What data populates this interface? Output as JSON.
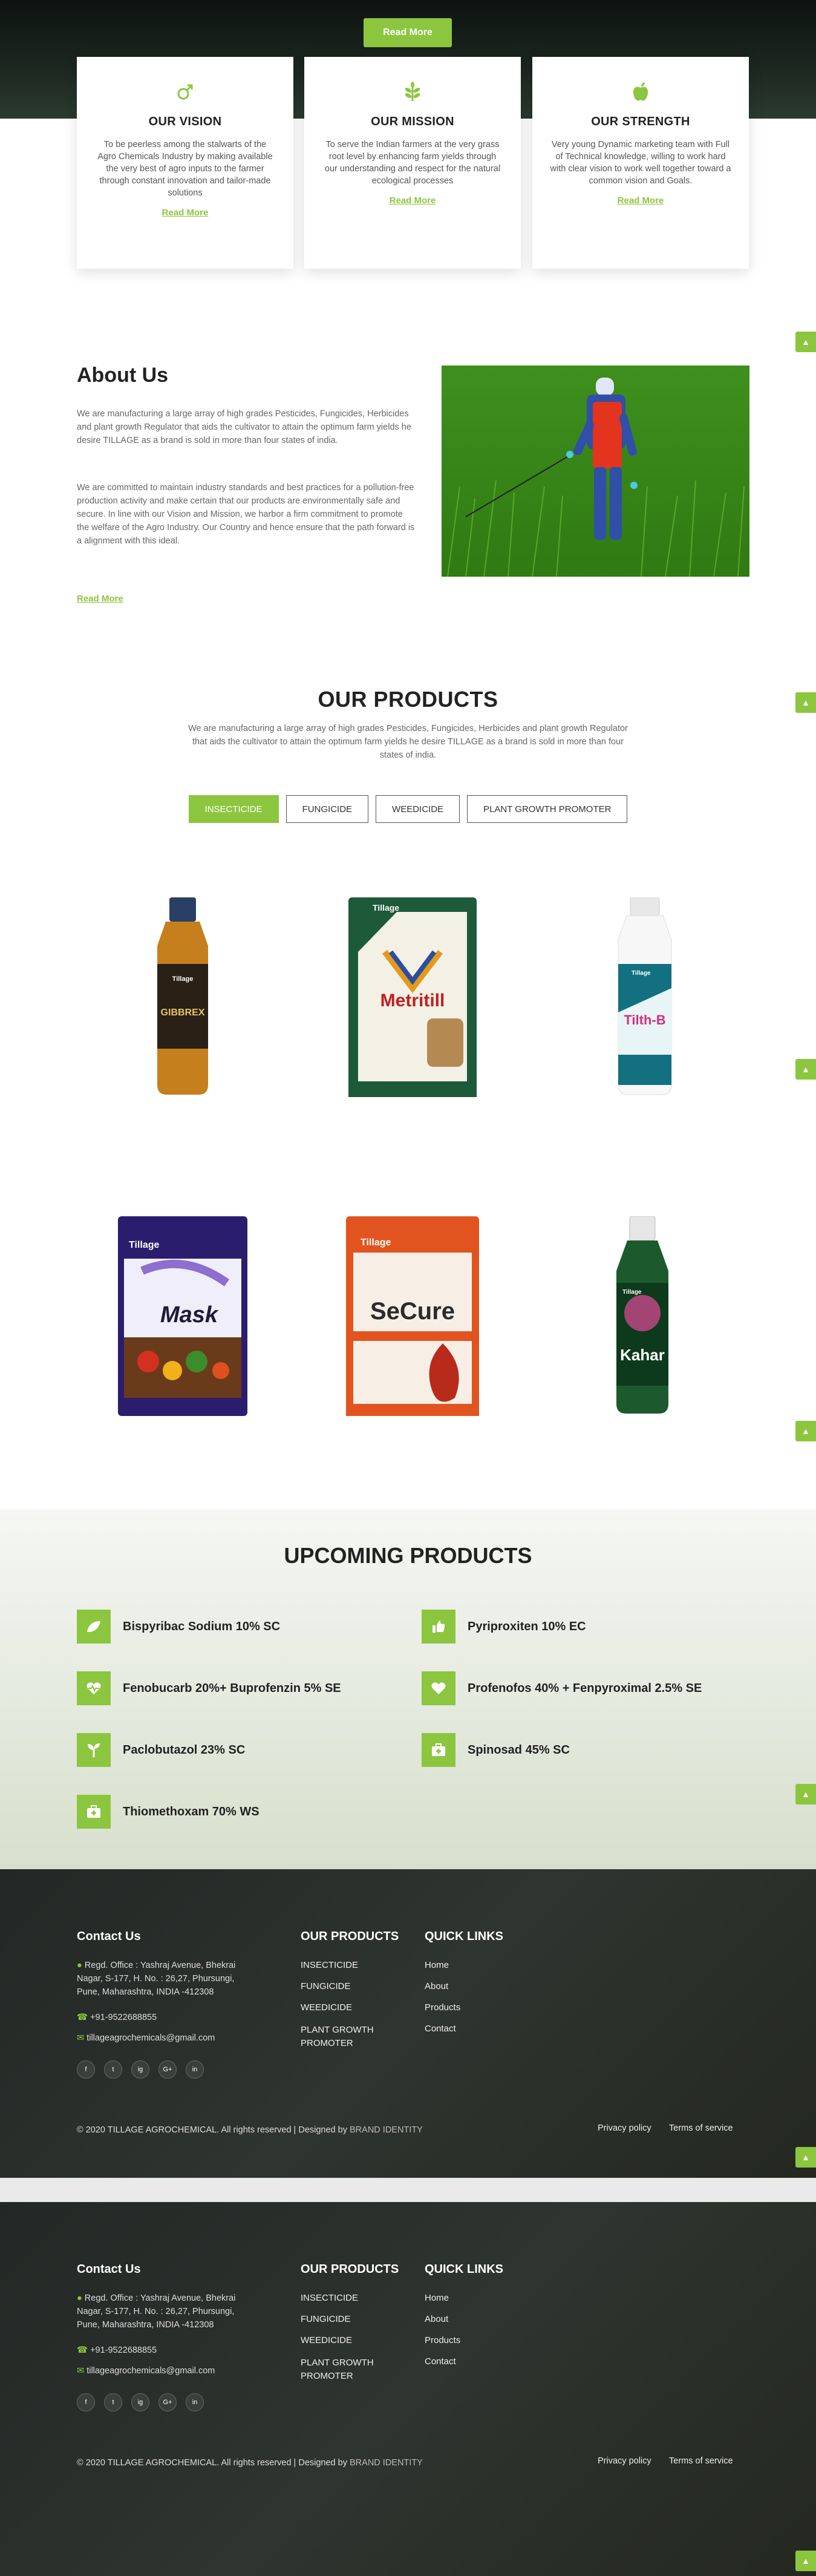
{
  "hero": {
    "read_more": "Read More"
  },
  "cards": [
    {
      "title": "OUR VISION",
      "text": "To be peerless among the stalwarts of the Agro Chemicals Industry by making available the very best of agro inputs to the farmer through constant innovation and tailor-made solutions",
      "link": "Read More",
      "icon": "gender-leaf-icon"
    },
    {
      "title": "OUR MISSION",
      "text": "To serve the Indian farmers at the very grass root level by enhancing farm yields through our understanding and respect for the natural ecological processes",
      "link": "Read More",
      "icon": "leaf-icon"
    },
    {
      "title": "OUR STRENGTH",
      "text": "Very young Dynamic marketing team with Full of Technical knowledge, willing to work hard with clear vision to work well together toward a common vision and Goals.",
      "link": "Read More",
      "icon": "apple-icon"
    }
  ],
  "about": {
    "title": "About Us",
    "p1": "We are manufacturing a large array of high grades Pesticides, Fungicides, Herbicides and plant growth Regulator that aids the cultivator to attain the optimum farm yields he desire TILLAGE as a brand is sold in more than four states of india.",
    "p2": "We are committed to maintain industry standards and best practices for a pollution-free production activity and make certain that our products are environmentally safe and secure. In line with our Vision and Mission, we harbor a firm commitment to promote the welfare of the Agro Industry. Our Country and hence ensure that the path forward is a alignment with this ideal.",
    "read_more": "Read More"
  },
  "products": {
    "title": "OUR PRODUCTS",
    "text": "We are manufacturing a large array of high grades Pesticides, Fungicides, Herbicides and plant growth Regulator that aids the cultivator to attain the optimum farm yields he desire TILLAGE as a brand is sold in more than four states of india.",
    "tabs": [
      "INSECTICIDE",
      "FUNGICIDE",
      "WEEDICIDE",
      "PLANT GROWTH PROMOTER"
    ],
    "items": [
      {
        "brand": "Tillage",
        "name": "GIBBREX"
      },
      {
        "brand": "Tillage",
        "name": "Metritill"
      },
      {
        "brand": "Tillage",
        "name": "Tilth-B"
      },
      {
        "brand": "Tillage",
        "name": "Mask"
      },
      {
        "brand": "Tillage",
        "name": "SeCure"
      },
      {
        "brand": "Tillage",
        "name": "Kahar"
      }
    ],
    "colors": {
      "accent": "#8cc63f"
    }
  },
  "upcoming": {
    "title": "UPCOMING PRODUCTS",
    "items": [
      {
        "label": "Bispyribac Sodium 10% SC",
        "icon": "leaf-icon"
      },
      {
        "label": "Pyriproxiten 10% EC",
        "icon": "thumbs-up-icon"
      },
      {
        "label": "Fenobucarb 20%+ Buprofenzin 5% SE",
        "icon": "heartbeat-icon"
      },
      {
        "label": "Profenofos 40% + Fenpyroximal 2.5% SE",
        "icon": "heart-icon"
      },
      {
        "label": "Paclobutazol 23% SC",
        "icon": "seedling-icon"
      },
      {
        "label": "Spinosad 45% SC",
        "icon": "medkit-icon"
      },
      {
        "label": "Thiomethoxam 70% WS",
        "icon": "medkit-icon"
      }
    ]
  },
  "footer": {
    "contact_title": "Contact Us",
    "address": "Regd. Office : Yashraj Avenue, Bhekrai Nagar, S-177, H. No. : 26,27, Phursungi, Pune, Maharashtra, INDIA -412308",
    "phone": "+91-9522688855",
    "email": "tillageagrochemicals@gmail.com",
    "products_title": "OUR PRODUCTS",
    "products": [
      "INSECTICIDE",
      "FUNGICIDE",
      "WEEDICIDE",
      "PLANT GROWTH PROMOTER"
    ],
    "links_title": "QUICK LINKS",
    "links": [
      "Home",
      "About",
      "Products",
      "Contact"
    ],
    "social": [
      "f",
      "t",
      "ig",
      "G+",
      "in"
    ],
    "copyright": "© 2020 TILLAGE AGROCHEMICAL. All rights reserved | Designed by",
    "designer": "BRAND IDENTITY",
    "privacy": "Privacy policy",
    "terms": "Terms of service"
  }
}
